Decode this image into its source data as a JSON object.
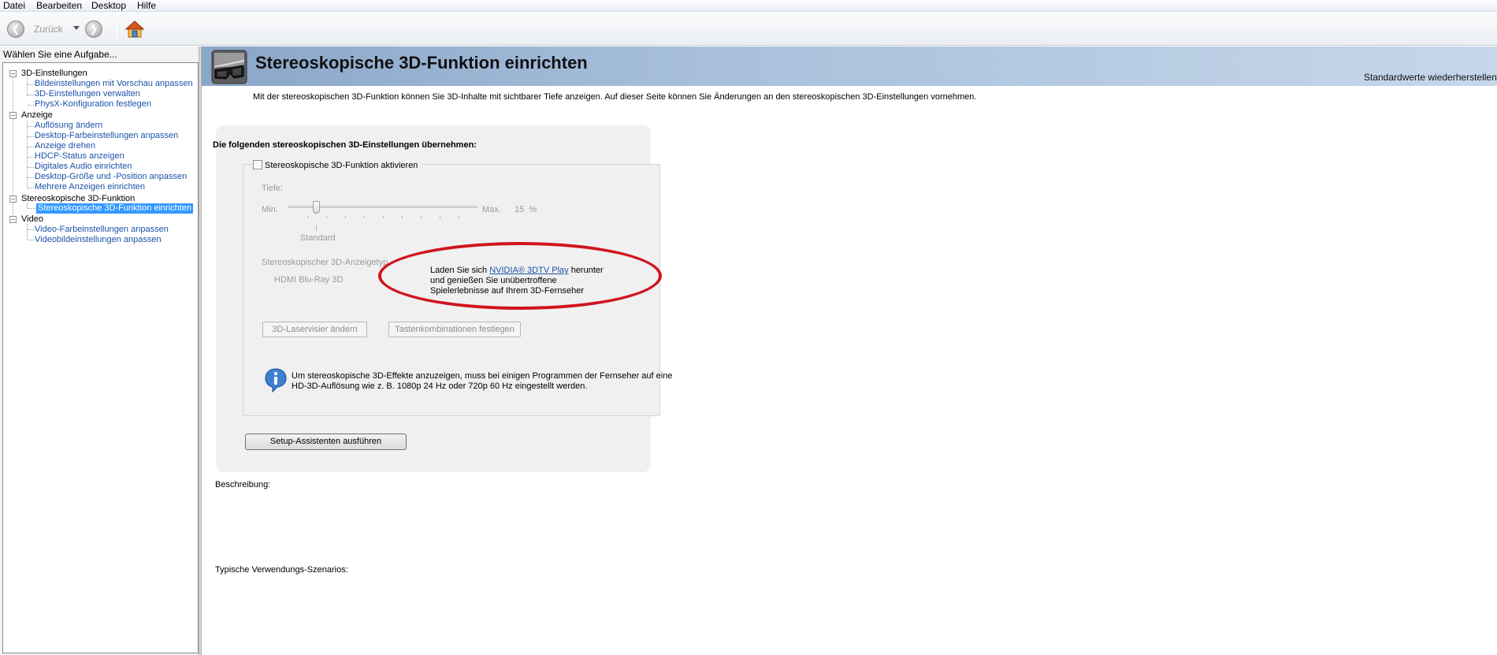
{
  "menu": {
    "items": [
      "Datei",
      "Bearbeiten",
      "Desktop",
      "Hilfe"
    ]
  },
  "toolbar": {
    "back_label": "Zurück",
    "back_icon": "arrow-left-icon",
    "forward_icon": "arrow-right-icon",
    "home_icon": "home-icon"
  },
  "sidebar": {
    "title": "Wählen Sie eine Aufgabe...",
    "groups": [
      {
        "label": "3D-Einstellungen",
        "items": [
          "Bildeinstellungen mit Vorschau anpassen",
          "3D-Einstellungen verwalten",
          "PhysX-Konfiguration festlegen"
        ]
      },
      {
        "label": "Anzeige",
        "items": [
          "Auflösung ändern",
          "Desktop-Farbeinstellungen anpassen",
          "Anzeige drehen",
          "HDCP-Status anzeigen",
          "Digitales Audio einrichten",
          "Desktop-Größe und -Position anpassen",
          "Mehrere Anzeigen einrichten"
        ]
      },
      {
        "label": "Stereoskopische 3D-Funktion",
        "items": [
          "Stereoskopische 3D-Funktion einrichten"
        ]
      },
      {
        "label": "Video",
        "items": [
          "Video-Farbeinstellungen anpassen",
          "Videobildeinstellungen anpassen"
        ]
      }
    ],
    "selected_item": "Stereoskopische 3D-Funktion einrichten"
  },
  "banner": {
    "title": "Stereoskopische 3D-Funktion einrichten",
    "reset_link": "Standardwerte wiederherstellen"
  },
  "intro": "Mit der stereoskopischen 3D-Funktion können Sie 3D-Inhalte mit sichtbarer Tiefe anzeigen. Auf dieser Seite können Sie Änderungen an den stereoskopischen 3D-Einstellungen vornehmen.",
  "settings": {
    "heading": "Die folgenden stereoskopischen 3D-Einstellungen übernehmen:",
    "enable_checkbox_label": "Stereoskopische 3D-Funktion aktivieren",
    "enable_checked": false,
    "depth": {
      "label": "Tiefe:",
      "min_label": "Min.",
      "max_label": "Max.",
      "value_text": "15  %",
      "value_percent": 15,
      "standard_label": "Standard"
    },
    "display_type_label": "Stereoskopischer 3D-Anzeigetyp",
    "display_type_value": "HDMI Blu-Ray 3D",
    "promo_prefix": "Laden Sie sich ",
    "promo_link": "NVIDIA® 3DTV Play",
    "promo_suffix": " herunter",
    "promo_line2": "und genießen Sie unübertroffene",
    "promo_line3": "Spielerlebnisse auf Ihrem 3D-Fernseher",
    "laser_button": "3D-Laservisier ändern",
    "hotkeys_button": "Tastenkombinationen festlegen",
    "info_line1": "Um stereoskopische 3D-Effekte anzuzeigen, muss bei einigen Programmen der Fernseher auf eine",
    "info_line2": "HD-3D-Auflösung wie z. B. 1080p 24 Hz oder 720p 60 Hz eingestellt werden.",
    "setup_button": "Setup-Assistenten ausführen"
  },
  "description_label": "Beschreibung:",
  "scenarios_label": "Typische Verwendungs-Szenarios:",
  "colors": {
    "link": "#1c52a8",
    "selection": "#3399ff",
    "annotation_ellipse": "#d0141c"
  }
}
